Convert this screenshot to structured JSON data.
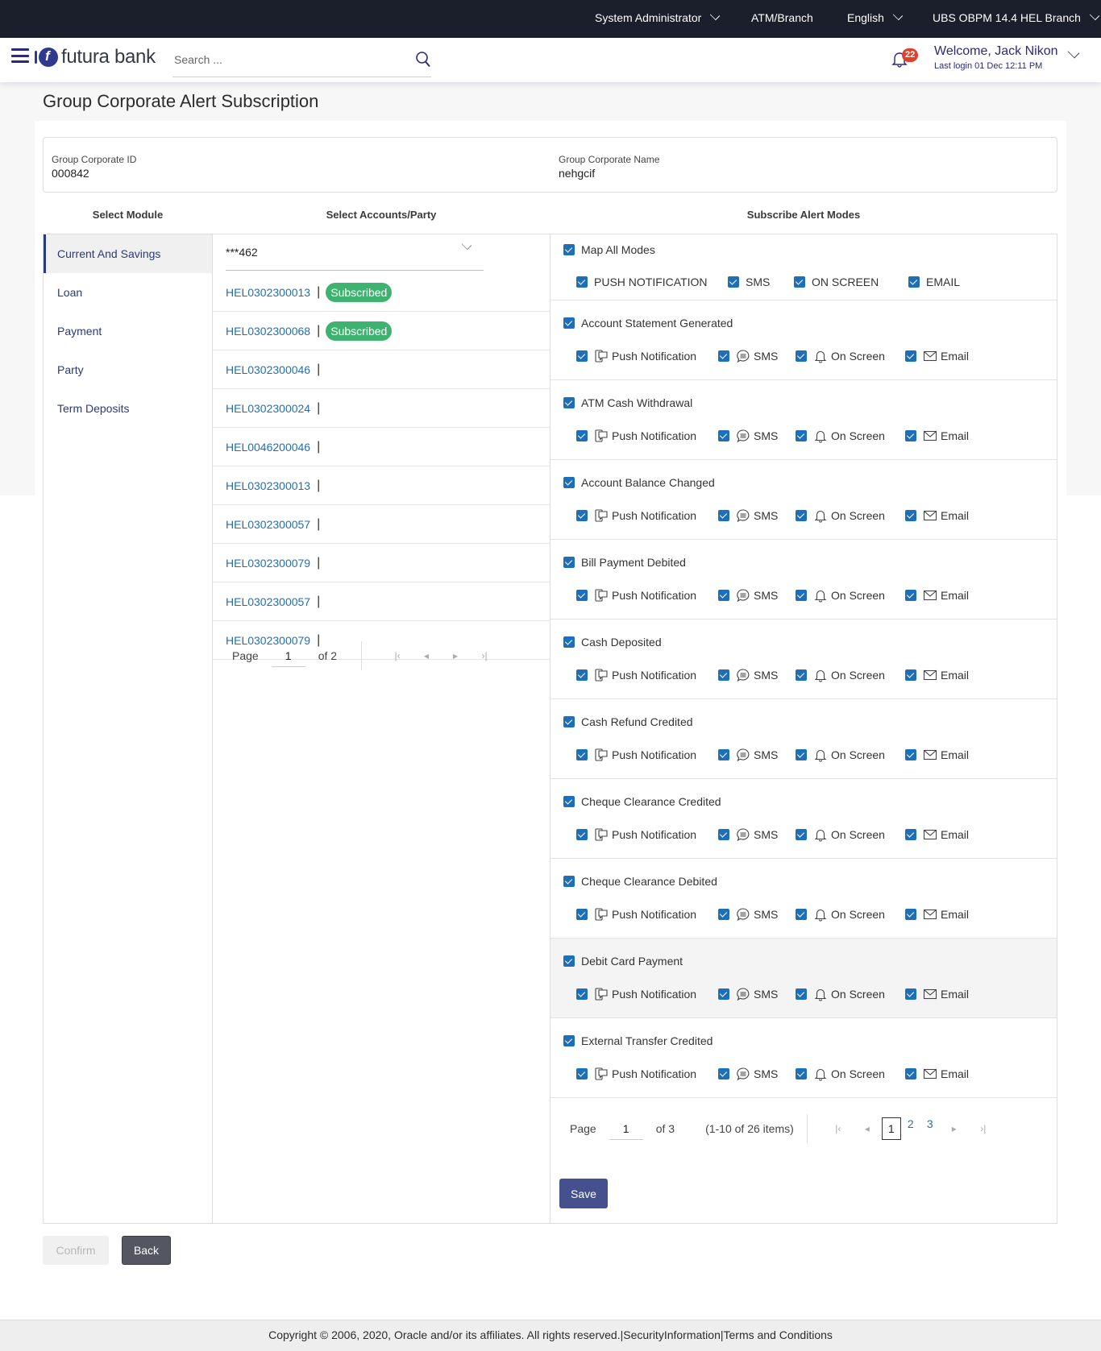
{
  "topbar": {
    "role": "System Administrator",
    "atm_branch": "ATM/Branch",
    "language": "English",
    "branch": "UBS OBPM 14.4 HEL Branch"
  },
  "header": {
    "brand": "futura bank",
    "search_placeholder": "Search ...",
    "notification_count": "22",
    "welcome": "Welcome, Jack Nikon",
    "last_login": "Last login 01 Dec 12:11 PM"
  },
  "page": {
    "title": "Group Corporate Alert Subscription"
  },
  "info": {
    "id_label": "Group Corporate ID",
    "id_value": "000842",
    "name_label": "Group Corporate Name",
    "name_value": "nehgcif"
  },
  "columns": {
    "module": "Select Module",
    "accounts": "Select Accounts/Party",
    "alerts": "Subscribe Alert Modes"
  },
  "modules": [
    {
      "label": "Current And Savings",
      "active": true
    },
    {
      "label": "Loan",
      "active": false
    },
    {
      "label": "Payment",
      "active": false
    },
    {
      "label": "Party",
      "active": false
    },
    {
      "label": "Term Deposits",
      "active": false
    }
  ],
  "accounts": {
    "selected": "***462",
    "items": [
      {
        "id": "HEL0302300013",
        "status": "Subscribed"
      },
      {
        "id": "HEL0302300068",
        "status": "Subscribed"
      },
      {
        "id": "HEL0302300046",
        "status": ""
      },
      {
        "id": "HEL0302300024",
        "status": ""
      },
      {
        "id": "HEL0046200046",
        "status": ""
      },
      {
        "id": "HEL0302300013",
        "status": ""
      },
      {
        "id": "HEL0302300057",
        "status": ""
      },
      {
        "id": "HEL0302300079",
        "status": ""
      },
      {
        "id": "HEL0302300057",
        "status": ""
      },
      {
        "id": "HEL0302300079",
        "status": ""
      }
    ],
    "pager": {
      "label": "Page",
      "current": "1",
      "of_label": "of 2"
    }
  },
  "map_all": {
    "label": "Map All Modes",
    "checked": true,
    "modes": [
      {
        "label": "PUSH NOTIFICATION",
        "checked": true
      },
      {
        "label": "SMS",
        "checked": true
      },
      {
        "label": "ON SCREEN",
        "checked": true
      },
      {
        "label": "EMAIL",
        "checked": true
      }
    ]
  },
  "mode_labels": {
    "push": "Push Notification",
    "sms": "SMS",
    "onscreen": "On Screen",
    "email": "Email"
  },
  "alerts": [
    {
      "name": "Account Statement Generated",
      "checked": true,
      "push": true,
      "sms": true,
      "onscreen": true,
      "email": true
    },
    {
      "name": "ATM Cash Withdrawal",
      "checked": true,
      "push": true,
      "sms": true,
      "onscreen": true,
      "email": true
    },
    {
      "name": "Account Balance Changed",
      "checked": true,
      "push": true,
      "sms": true,
      "onscreen": true,
      "email": true
    },
    {
      "name": "Bill Payment Debited",
      "checked": true,
      "push": true,
      "sms": true,
      "onscreen": true,
      "email": true
    },
    {
      "name": "Cash Deposited",
      "checked": true,
      "push": true,
      "sms": true,
      "onscreen": true,
      "email": true
    },
    {
      "name": "Cash Refund Credited",
      "checked": true,
      "push": true,
      "sms": true,
      "onscreen": true,
      "email": true
    },
    {
      "name": "Cheque Clearance Credited",
      "checked": true,
      "push": true,
      "sms": true,
      "onscreen": true,
      "email": true
    },
    {
      "name": "Cheque Clearance Debited",
      "checked": true,
      "push": true,
      "sms": true,
      "onscreen": true,
      "email": true
    },
    {
      "name": "Debit Card Payment",
      "checked": true,
      "push": true,
      "sms": true,
      "onscreen": true,
      "email": true,
      "highlighted": true
    },
    {
      "name": "External Transfer Credited",
      "checked": true,
      "push": true,
      "sms": true,
      "onscreen": true,
      "email": true
    }
  ],
  "alerts_pager": {
    "label": "Page",
    "current": "1",
    "of_label": "of 3",
    "summary": "(1-10 of 26 items)",
    "pages": [
      "1",
      "2",
      "3"
    ]
  },
  "buttons": {
    "save": "Save",
    "confirm": "Confirm",
    "back": "Back"
  },
  "footer": {
    "copyright": "Copyright © 2006, 2020, Oracle and/or its affiliates. All rights reserved.",
    "security": "SecurityInformation",
    "terms": "Terms and Conditions"
  },
  "colors": {
    "topbar_bg": "#1b1e2b",
    "brand": "#2b2a7a",
    "link": "#1f6fb8",
    "subscribed": "#3db36f",
    "save": "#45508f",
    "checkbox": "#1f6fb8"
  }
}
